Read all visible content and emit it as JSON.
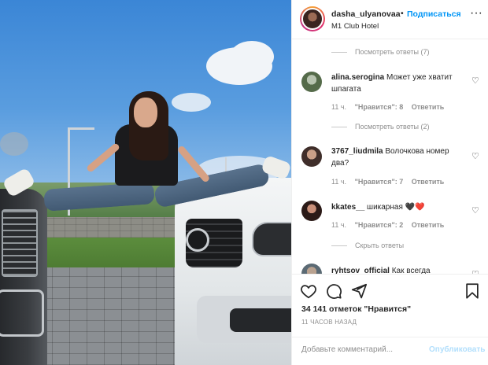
{
  "post": {
    "username": "dasha_ulyanovaa",
    "separator": "•",
    "follow_label": "Подписаться",
    "location": "M1 Club Hotel",
    "more_label": "···"
  },
  "comments": [
    {
      "type": "replies",
      "label": "Посмотреть ответы (7)"
    },
    {
      "type": "comment",
      "user": "alina.serogina",
      "text": "Может уже хватит шпагата",
      "time": "11 ч.",
      "likes": "\"Нравится\": 8",
      "reply": "Ответить",
      "heart": "♡"
    },
    {
      "type": "replies",
      "label": "Посмотреть ответы (2)"
    },
    {
      "type": "comment",
      "user": "3767_liudmila",
      "text": "Волочкова номер два?",
      "time": "11 ч.",
      "likes": "\"Нравится\": 7",
      "reply": "Ответить",
      "heart": "♡"
    },
    {
      "type": "comment",
      "user": "kkates__",
      "text": "шикарная 🖤❤️",
      "time": "11 ч.",
      "likes": "\"Нравится\": 2",
      "reply": "Ответить",
      "heart": "♡"
    },
    {
      "type": "replies",
      "label": "Скрыть ответы"
    },
    {
      "type": "comment",
      "user": "ryhtsov_official",
      "text": "Как всегда",
      "heart": "♡"
    }
  ],
  "actions": {
    "likes": "34 141 отметок \"Нравится\"",
    "time_ago": "11 ЧАСОВ НАЗАД"
  },
  "add_comment": {
    "placeholder": "Добавьте комментарий...",
    "publish_label": "Опубликовать"
  },
  "colors": {
    "link_blue": "#0095f6",
    "publish_disabled": "#b2dffc",
    "muted_text": "#8e8e8e",
    "heart_red": "#ed4956"
  },
  "icons": [
    "more-icon",
    "heart-icon",
    "comment-icon",
    "share-icon",
    "bookmark-icon"
  ]
}
